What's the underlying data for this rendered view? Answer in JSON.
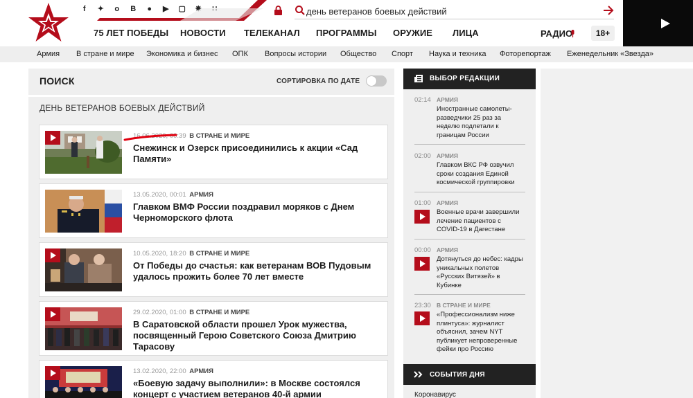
{
  "header": {
    "social_icons": [
      "facebook-icon",
      "twitter-icon",
      "odnoklassniki-icon",
      "vkontakte-icon",
      "messenger-icon",
      "youtube-icon",
      "instagram-icon",
      "livejournal-icon",
      "rss-icon"
    ],
    "social_glyphs": [
      "f",
      "✦",
      "o",
      "B",
      "●",
      "▶",
      "▢",
      "✵",
      "∷"
    ],
    "search_query": "день ветеранов боевых действий",
    "nav": [
      "75 ЛЕТ ПОБЕДЫ",
      "НОВОСТИ",
      "ТЕЛЕКАНАЛ",
      "ПРОГРАММЫ",
      "ОРУЖИЕ",
      "ЛИЦА"
    ],
    "radio_label": "РАДИО",
    "age_label": "18+",
    "brand_red": "#b40d1b"
  },
  "subnav": [
    "Армия",
    "В стране и мире",
    "Экономика и бизнес",
    "ОПК",
    "Вопросы истории",
    "Общество",
    "Спорт",
    "Наука и техника",
    "Фоторепортаж",
    "Еженедельник «Звезда»"
  ],
  "search": {
    "title": "ПОИСК",
    "sort_label": "СОРТИРОВКА ПО ДАТЕ",
    "sort_by_date": false,
    "query_title": "ДЕНЬ ВЕТЕРАНОВ БОЕВЫХ ДЕЙСТВИЙ"
  },
  "results": [
    {
      "date": "16.06.2020, 00:39",
      "category": "В СТРАНЕ И МИРЕ",
      "title": "Снежинск и Озерск присоединились к акции «Сад Памяти»"
    },
    {
      "date": "13.05.2020, 00:01",
      "category": "АРМИЯ",
      "title": "Главком ВМФ России поздравил моряков с Днем Черноморского флота"
    },
    {
      "date": "10.05.2020, 18:20",
      "category": "В СТРАНЕ И МИРЕ",
      "title": "От Победы до счастья: как ветеранам ВОВ Пудовым удалось прожить более 70 лет вместе"
    },
    {
      "date": "29.02.2020, 01:00",
      "category": "В СТРАНЕ И МИРЕ",
      "title": "В Саратовской области прошел Урок мужества, посвященный Герою Советского Союза Дмитрию Тарасову"
    },
    {
      "date": "13.02.2020, 22:00",
      "category": "АРМИЯ",
      "title": "«Боевую задачу выполнили»: в Москве состоялся концерт с участием ветеранов 40-й армии"
    }
  ],
  "editors_choice": {
    "title": "ВЫБОР РЕДАКЦИИ",
    "items": [
      {
        "time": "02:14",
        "category": "АРМИЯ",
        "text": "Иностранные самолеты-разведчики 25 раз за неделю подлетали к границам России",
        "video": false
      },
      {
        "time": "02:00",
        "category": "АРМИЯ",
        "text": "Главком ВКС РФ озвучил сроки создания Единой космической группировки",
        "video": false
      },
      {
        "time": "01:00",
        "category": "АРМИЯ",
        "text": "Военные врачи завершили лечение пациентов с COVID-19 в Дагестане",
        "video": true
      },
      {
        "time": "00:00",
        "category": "АРМИЯ",
        "text": "Дотянуться до небес: кадры уникальных полетов «Русских Витязей» в Кубинке",
        "video": true
      },
      {
        "time": "23:30",
        "category": "В СТРАНЕ И МИРЕ",
        "text": "«Профессионализм ниже плинтуса»: журналист объяснил, зачем NYT публикует непроверенные фейки про Россию",
        "video": true
      }
    ]
  },
  "events": {
    "title": "СОБЫТИЯ ДНЯ",
    "first_item": "Коронавирус"
  }
}
